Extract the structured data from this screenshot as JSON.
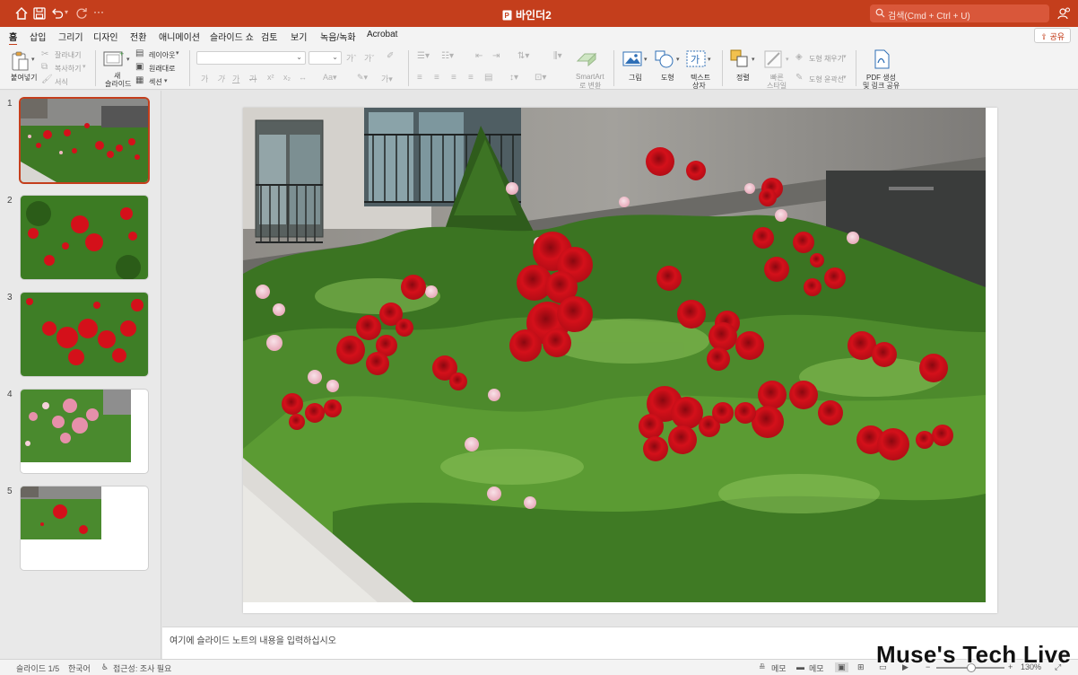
{
  "app": {
    "doc_title": "바인더2",
    "search_placeholder": "검색(Cmd + Ctrl + U)"
  },
  "tabs": [
    "홈",
    "삽입",
    "그리기",
    "디자인",
    "전환",
    "애니메이션",
    "슬라이드 쇼",
    "검토",
    "보기",
    "녹음/녹화",
    "Acrobat"
  ],
  "share_label": "공유",
  "ribbon": {
    "paste": "붙여넣기",
    "cut": "잘라내기",
    "copy": "복사하기",
    "format": "서식",
    "new_slide_1": "새",
    "new_slide_2": "슬라이드",
    "layout": "레이아웃",
    "reset": "원래대로",
    "section": "섹션",
    "smartart_1": "SmartArt",
    "smartart_2": "로 변환",
    "picture": "그림",
    "shape": "도형",
    "textbox_1": "텍스트",
    "textbox_2": "상자",
    "arrange": "정렬",
    "quick_style_1": "빠른",
    "quick_style_2": "스타일",
    "shape_fill": "도형 채우기",
    "shape_outline": "도형 윤곽선",
    "pdf_1": "PDF 생성",
    "pdf_2": "및 링크 공유"
  },
  "slides": [
    {
      "number": "1"
    },
    {
      "number": "2"
    },
    {
      "number": "3"
    },
    {
      "number": "4"
    },
    {
      "number": "5"
    }
  ],
  "notes_placeholder": "여기에 슬라이드 노트의 내용을 입력하십시오",
  "status": {
    "slide_counter": "슬라이드 1/5",
    "language": "한국어",
    "accessibility": "접근성: 조사 필요",
    "notes": "메모",
    "comments": "메모",
    "zoom": "130%"
  },
  "watermark": "Muse's Tech Live",
  "colors": {
    "accent": "#c43e1c",
    "rose_red": "#d4101a",
    "foliage": "#3d7a22"
  }
}
